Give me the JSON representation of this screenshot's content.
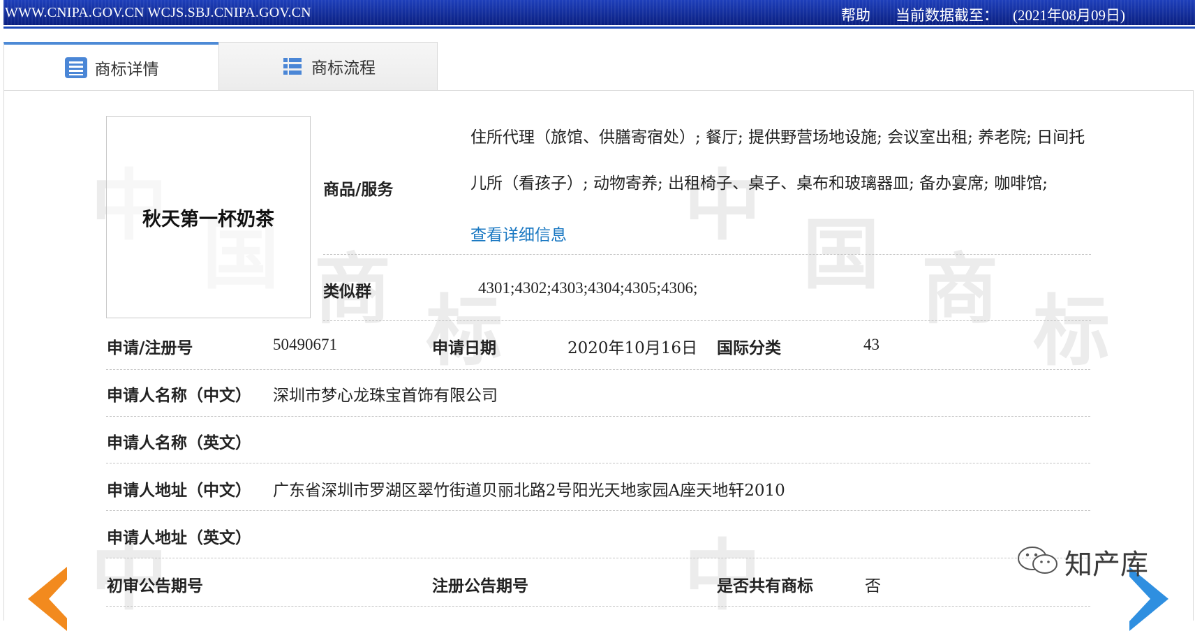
{
  "topbar": {
    "url": "WWW.CNIPA.GOV.CN WCJS.SBJ.CNIPA.GOV.CN",
    "help": "帮助",
    "date_label": "当前数据截至：",
    "date_value": "(2021年08月09日)"
  },
  "tabs": [
    {
      "label": "商标详情",
      "icon": "list-document-icon",
      "active": true
    },
    {
      "label": "商标流程",
      "icon": "flow-list-icon",
      "active": false
    }
  ],
  "trademark": {
    "name": "秋天第一杯奶茶",
    "services_label": "商品/服务",
    "services_text": "住所代理（旅馆、供膳寄宿处）; 餐厅; 提供野营场地设施; 会议室出租; 养老院; 日间托儿所（看孩子）; 动物寄养; 出租椅子、桌子、桌布和玻璃器皿; 备办宴席; 咖啡馆;",
    "details_link": "查看详细信息",
    "similar_group_label": "类似群",
    "similar_group_value": "4301;4302;4303;4304;4305;4306;"
  },
  "rows": {
    "reg_no_label": "申请/注册号",
    "reg_no_value": "50490671",
    "app_date_label": "申请日期",
    "app_date_value": "2020年10月16日",
    "intl_class_label": "国际分类",
    "intl_class_value": "43",
    "applicant_cn_label": "申请人名称（中文）",
    "applicant_cn_value": "深圳市梦心龙珠宝首饰有限公司",
    "applicant_en_label": "申请人名称（英文）",
    "applicant_en_value": "",
    "address_cn_label": "申请人地址（中文）",
    "address_cn_value": "广东省深圳市罗湖区翠竹街道贝丽北路2号阳光天地家园A座天地轩2010",
    "address_en_label": "申请人地址（英文）",
    "address_en_value": "",
    "prelim_pub_label": "初审公告期号",
    "prelim_pub_value": "",
    "reg_pub_label": "注册公告期号",
    "reg_pub_value": "",
    "shared_label": "是否共有商标",
    "shared_value": "否"
  },
  "credit": {
    "text": "知产库",
    "icon": "wechat-icon"
  },
  "watermark": {
    "chars": [
      "中",
      "国",
      "商",
      "标"
    ]
  },
  "colors": {
    "topbar": "#0f2a9c",
    "link": "#1a78c2",
    "tab_accent": "#4d8ad6",
    "arrow_left": "#f28a1e",
    "arrow_right": "#2f8fe0"
  }
}
